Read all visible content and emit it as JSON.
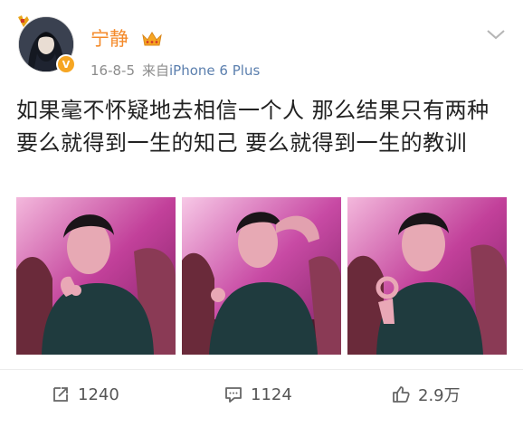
{
  "post": {
    "username": "宁静",
    "date": "16-8-5",
    "source_prefix": "来自",
    "source": "iPhone 6 Plus",
    "text": "如果毫不怀疑地去相信一个人  那么结果只有两种  要么就得到一生的知己  要么就得到一生的教训",
    "images": [
      {
        "alt": "photo-1"
      },
      {
        "alt": "photo-2"
      },
      {
        "alt": "photo-3"
      }
    ]
  },
  "actions": {
    "repost_count": "1240",
    "comment_count": "1124",
    "like_count": "2.9万"
  },
  "icons": {
    "repost": "share-icon",
    "comment": "comment-icon",
    "like": "thumbs-up-icon",
    "menu": "chevron-down-icon",
    "crown": "crown-icon",
    "verified": "verified-v-icon"
  },
  "colors": {
    "username": "#f48a2a",
    "source": "#5b7fae",
    "badge": "#f6a623",
    "meta": "#8c8c8c"
  },
  "verified_glyph": "V"
}
